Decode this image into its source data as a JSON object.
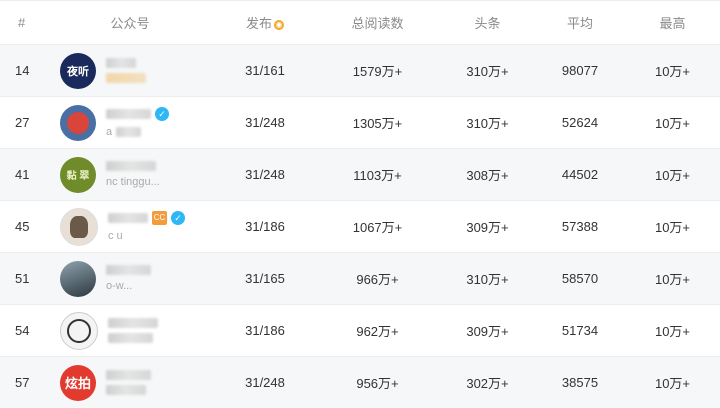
{
  "header": {
    "rank": "#",
    "account": "公众号",
    "publish": "发布",
    "total_reads": "总阅读数",
    "headline": "头条",
    "average": "平均",
    "max": "最高"
  },
  "rows": [
    {
      "rank": "14",
      "avatar_text": "夜听",
      "avatar_color": "#1b2a5c",
      "sub": "",
      "pub": "31/161",
      "total": "1579万+",
      "head": "310万+",
      "avg": "98077",
      "max": "10万+"
    },
    {
      "rank": "27",
      "avatar_text": "",
      "avatar_color": "#d9453a",
      "sub": "a",
      "pub": "31/248",
      "total": "1305万+",
      "head": "310万+",
      "avg": "52624",
      "max": "10万+"
    },
    {
      "rank": "41",
      "avatar_text": "黏 翠",
      "avatar_color": "#6f8b2a",
      "sub": "nc  tinggu...",
      "pub": "31/248",
      "total": "1103万+",
      "head": "308万+",
      "avg": "44502",
      "max": "10万+"
    },
    {
      "rank": "45",
      "avatar_text": "",
      "avatar_color": "#e8e0d6",
      "sub": "c  u",
      "pub": "31/186",
      "total": "1067万+",
      "head": "309万+",
      "avg": "57388",
      "max": "10万+"
    },
    {
      "rank": "51",
      "avatar_text": "",
      "avatar_color": "#3d4a55",
      "sub": "o-w...",
      "pub": "31/165",
      "total": "966万+",
      "head": "310万+",
      "avg": "58570",
      "max": "10万+"
    },
    {
      "rank": "54",
      "avatar_text": "",
      "avatar_color": "#f4f4f4",
      "sub": "",
      "pub": "31/186",
      "total": "962万+",
      "head": "309万+",
      "avg": "51734",
      "max": "10万+"
    },
    {
      "rank": "57",
      "avatar_text": "炫拍",
      "avatar_color": "#e23a2e",
      "sub": "",
      "pub": "31/248",
      "total": "956万+",
      "head": "302万+",
      "avg": "38575",
      "max": "10万+"
    }
  ],
  "badges": {
    "cc": "CC",
    "verified": "✓",
    "publish_icon": "◉"
  }
}
